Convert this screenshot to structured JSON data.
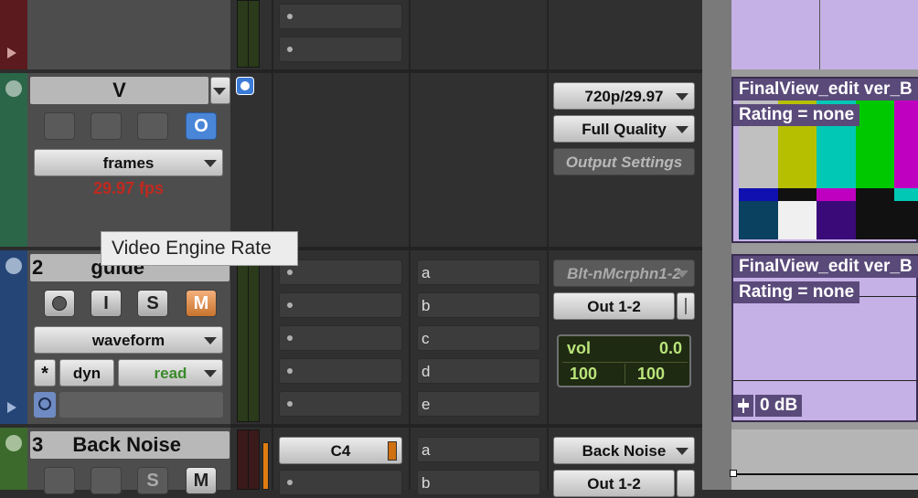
{
  "tooltip": "Video Engine Rate",
  "tracks": [
    {
      "id": "video",
      "name": "V",
      "view": "frames",
      "rate_text": "29.97 fps",
      "online_button": "O",
      "video_format": "720p/29.97",
      "quality": "Full Quality",
      "output_settings": "Output Settings",
      "clip_name": "FinalView_edit ver_B",
      "clip_rating": "Rating = none"
    },
    {
      "id": "guide",
      "number": "2",
      "name": "guide",
      "buttons": {
        "solo": "S",
        "mute": "M",
        "input": "I"
      },
      "view": "waveform",
      "dyn": "dyn",
      "automation": "read",
      "asterisk": "*",
      "sends": [
        "a",
        "b",
        "c",
        "d",
        "e"
      ],
      "input": "Blt-nMcrphn1-2",
      "output": "Out 1-2",
      "vol_label": "vol",
      "vol_value": "0.0",
      "pan_left": "100",
      "pan_right": "100",
      "clip_name": "FinalView_edit ver_B",
      "clip_rating": "Rating = none",
      "clip_gain": "0 dB"
    },
    {
      "id": "back-noise",
      "number": "3",
      "name": "Back Noise",
      "buttons": {
        "solo": "S",
        "mute": "M"
      },
      "insert": "C4",
      "sends": [
        "a",
        "b"
      ],
      "input": "Back Noise",
      "output": "Out 1-2"
    }
  ],
  "colors": {
    "video_strip": "#2f6b4b",
    "guide_strip": "#26477a",
    "backnoise_strip": "#3d6f2e",
    "top_strip": "#6b1e22",
    "clip_purple": "#c6b1e6",
    "rate_red": "#c0291f"
  }
}
